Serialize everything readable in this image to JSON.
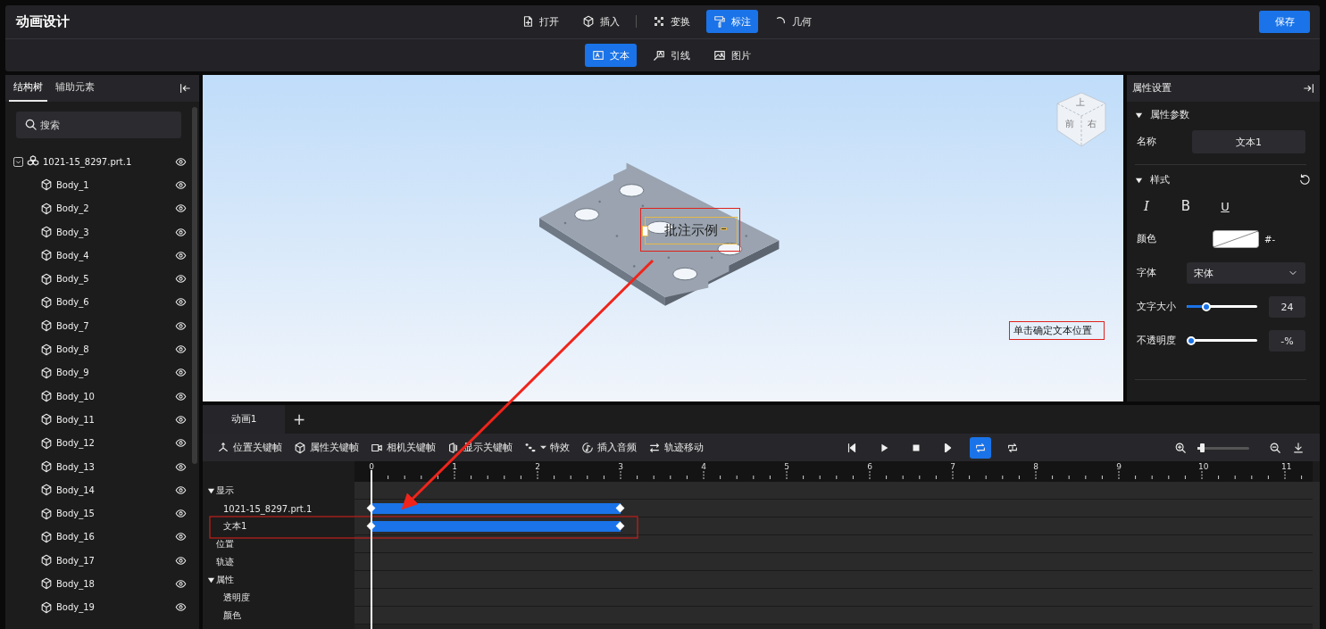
{
  "app": {
    "title": "动画设计",
    "save_button": "保存"
  },
  "toolbar": [
    {
      "label": "打开",
      "selected": false
    },
    {
      "label": "插入",
      "selected": false
    },
    {
      "label": "变换",
      "selected": false
    },
    {
      "label": "标注",
      "selected": true
    },
    {
      "label": "几何",
      "selected": false
    }
  ],
  "subtoolbar": [
    {
      "label": "文本",
      "selected": true
    },
    {
      "label": "引线",
      "selected": false
    },
    {
      "label": "图片",
      "selected": false
    }
  ],
  "left_panel": {
    "tabs": [
      {
        "label": "结构树",
        "selected": true
      },
      {
        "label": "辅助元素",
        "selected": false
      }
    ],
    "search": {
      "placeholder": "搜索"
    },
    "tree": [
      {
        "label": "1021-15_8297.prt.1",
        "expanded": true,
        "visible": true,
        "children": [
          {
            "label": "Body_1",
            "visible": true
          },
          {
            "label": "Body_2",
            "visible": true
          },
          {
            "label": "Body_3",
            "visible": true
          },
          {
            "label": "Body_4",
            "visible": true
          },
          {
            "label": "Body_5",
            "visible": true
          },
          {
            "label": "Body_6",
            "visible": true
          },
          {
            "label": "Body_7",
            "visible": true
          },
          {
            "label": "Body_8",
            "visible": true
          },
          {
            "label": "Body_9",
            "visible": true
          },
          {
            "label": "Body_10",
            "visible": true
          },
          {
            "label": "Body_11",
            "visible": true
          },
          {
            "label": "Body_12",
            "visible": true
          },
          {
            "label": "Body_13",
            "visible": true
          },
          {
            "label": "Body_14",
            "visible": true
          },
          {
            "label": "Body_15",
            "visible": true
          },
          {
            "label": "Body_16",
            "visible": true
          },
          {
            "label": "Body_17",
            "visible": true
          },
          {
            "label": "Body_18",
            "visible": true
          },
          {
            "label": "Body_19",
            "visible": true
          }
        ]
      }
    ]
  },
  "viewport": {
    "annotation": {
      "text": "批注示例",
      "selected": true
    },
    "hint": "单击确定文本位置",
    "view_cube": [
      "上",
      "前",
      "右"
    ]
  },
  "properties": {
    "title": "属性设置",
    "params": {
      "title": "属性参数",
      "expanded": true,
      "name_label": "名称",
      "name_value": "文本1"
    },
    "style": {
      "title": "样式",
      "expanded": true,
      "format_buttons": [
        {
          "label": "I",
          "kind": "italic"
        },
        {
          "label": "B",
          "kind": "bold"
        },
        {
          "label": "U",
          "kind": "underline"
        }
      ],
      "rows": [
        {
          "kind": "color",
          "label": "颜色",
          "value": "#-"
        },
        {
          "kind": "select",
          "label": "字体",
          "value": "宋体"
        },
        {
          "kind": "slider",
          "label": "文字大小",
          "level": 0.25,
          "value": "24"
        },
        {
          "kind": "slider",
          "label": "不透明度",
          "level": 0,
          "value": "-%"
        }
      ]
    }
  },
  "timeline": {
    "tabs": [
      {
        "label": "动画1",
        "selected": true
      }
    ],
    "add_tab": "+",
    "tools": [
      {
        "label": "位置关键帧",
        "dropdown": false
      },
      {
        "label": "属性关键帧",
        "dropdown": false
      },
      {
        "label": "相机关键帧",
        "dropdown": false
      },
      {
        "label": "显示关键帧",
        "dropdown": false
      },
      {
        "label": "特效",
        "dropdown": true
      },
      {
        "label": "插入音频",
        "dropdown": false
      },
      {
        "label": "轨迹移动",
        "dropdown": false
      }
    ],
    "playback": [
      {
        "kind": "prev",
        "selected": false
      },
      {
        "kind": "play",
        "selected": false
      },
      {
        "kind": "stop",
        "selected": false
      },
      {
        "kind": "next",
        "selected": false
      },
      {
        "kind": "loop",
        "selected": true
      },
      {
        "kind": "loop-once",
        "selected": false
      }
    ],
    "zoom": {
      "level": 0.08
    },
    "ruler": [
      "0",
      "1",
      "2",
      "3",
      "4",
      "5",
      "6",
      "7",
      "8",
      "9",
      "10",
      "11"
    ],
    "playhead": {
      "level": 0
    },
    "tracks": [
      {
        "label": "显示",
        "expanded": true,
        "children": [
          {
            "label": "1021-15_8297.prt.1",
            "keyframes": [
              {
                "level": 0
              },
              {
                "level": 0.273
              }
            ]
          },
          {
            "label": "文本1",
            "keyframes": [
              {
                "level": 0
              },
              {
                "level": 0.273
              }
            ]
          }
        ]
      },
      {
        "label": "位置"
      },
      {
        "label": "轨迹"
      },
      {
        "label": "属性",
        "expanded": true,
        "children": [
          {
            "label": "透明度"
          },
          {
            "label": "颜色"
          }
        ]
      }
    ]
  }
}
